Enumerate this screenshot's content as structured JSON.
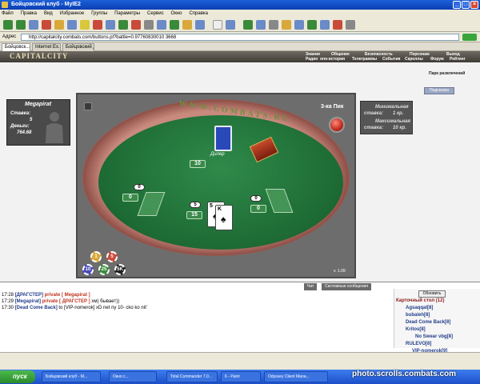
{
  "window": {
    "title": "Бойцовский клуб - MyIE2"
  },
  "menu": [
    "Файл",
    "Правка",
    "Вид",
    "Избранное",
    "Группы",
    "Параметры",
    "Сервис",
    "Окно",
    "Справка"
  ],
  "address": {
    "label": "Адрес",
    "url": "http://capitalcity.combats.com/buttons.pl?battle=0.97760830010 3668"
  },
  "tabs": [
    "Бойцовск...",
    "Internet Ex...",
    "Бойцовский д..."
  ],
  "site": {
    "logo": "CAPITALCITY",
    "nav_top": [
      "Знания",
      "Общение",
      "Безопасность",
      "Персонаж",
      "Выход"
    ],
    "nav_bottom": [
      "Радио",
      "опн-история",
      "Телеграммы",
      "События",
      "Скроллы",
      "Форум",
      "Рейтинг"
    ]
  },
  "side": {
    "link": "Парк развлечений",
    "button": "Подсказка"
  },
  "player": {
    "name": "Megapirat",
    "stake_label": "Ставка:",
    "stake": "5",
    "money_label": "Деньги:",
    "money": "764.68"
  },
  "table": {
    "ring_text": "WWW.COMBATS.RU",
    "bank": "3-ка Пик",
    "dealer_label": "Дилер",
    "dealer_score": "10",
    "left_bet": "0",
    "left_score": "0",
    "center_bet": "5",
    "center_score": "15",
    "right_bet": "0",
    "right_score": "0",
    "cards": [
      {
        "rank": "5",
        "suit": "♠"
      },
      {
        "rank": "K",
        "suit": "♠"
      }
    ],
    "chips": [
      "1",
      "5",
      "10",
      "25",
      "5K"
    ],
    "version": "v. 1.09"
  },
  "min_stake": {
    "line1": "Минимальная",
    "line2": "ставка:",
    "min_value": "1 кр.",
    "line3": "Максимальная",
    "line4": "ставка:",
    "max_value": "10 кр."
  },
  "chat": {
    "tabs": [
      "Чат",
      "Системные сообщения"
    ],
    "lines": [
      {
        "time": "17:28",
        "parts": [
          "[ДРАГСТЕР]",
          "private [ Megapirat ]",
          ""
        ]
      },
      {
        "time": "17:29",
        "parts": [
          "[Megapirat]",
          "private [ ДРАГСТЕР ]",
          " хм) бывает))"
        ]
      },
      {
        "time": "17:30",
        "parts": [
          "[Dead Come Back]",
          " to [VIP-nomerok] xD net ny 10- cko ko nit'",
          ""
        ]
      }
    ]
  },
  "players_panel": {
    "refresh": "Обновить",
    "title": "Карточный стол (12)",
    "players": [
      "Agsaqqal[8]",
      "bubaleh[8]",
      "Dead Come Back[8]",
      "Kritos[8]",
      "No Swear vbg[8]",
      "RULEVO[8]",
      "VIP-nomerok[9]"
    ]
  },
  "taskbar": {
    "start": "пуск",
    "tasks": [
      "Бойцовский клуб - М...",
      "Окно с...",
      "Total Commander 7.0...",
      "6 - Paint",
      "Odyssey Client Mana..."
    ]
  },
  "watermark": "photo.scrolls.combats.com",
  "colors": {
    "felt": "#1d6a34",
    "titlebar": "#0a3fb4",
    "taskbar": "#1c4fc8"
  }
}
